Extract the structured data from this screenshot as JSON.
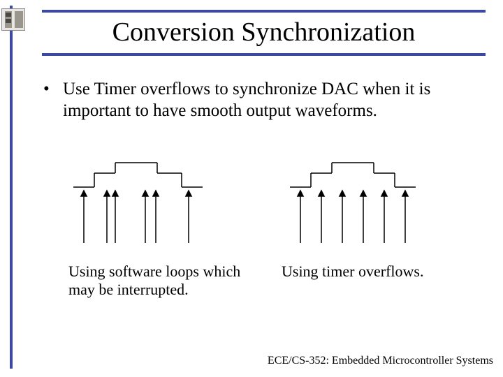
{
  "title": "Conversion Synchronization",
  "bullet": {
    "dot": "•",
    "text": "Use Timer overflows to synchronize DAC when it is important to have smooth output waveforms."
  },
  "captions": {
    "left": "Using software loops which may be interrupted.",
    "right": "Using timer overflows."
  },
  "footer": "ECE/CS-352: Embedded Microcontroller Systems",
  "chart_data": [
    {
      "type": "line",
      "title": "Using software loops which may be interrupted.",
      "description": "Staircase DAC output with 6 unevenly-spaced sample arrows (software loop timing with jitter).",
      "x_arrows": [
        15,
        48,
        60,
        103,
        118,
        165
      ],
      "step_levels": [
        0,
        20,
        35,
        35,
        20,
        0
      ],
      "step_x": [
        0,
        30,
        60,
        90,
        120,
        155,
        185
      ]
    },
    {
      "type": "line",
      "title": "Using timer overflows.",
      "description": "Staircase DAC output with 6 evenly-spaced sample arrows (timer-driven constant period).",
      "x_arrows": [
        15,
        45,
        75,
        105,
        135,
        165
      ],
      "step_levels": [
        0,
        20,
        35,
        35,
        20,
        0
      ],
      "step_x": [
        0,
        30,
        60,
        90,
        120,
        150,
        180
      ]
    }
  ]
}
